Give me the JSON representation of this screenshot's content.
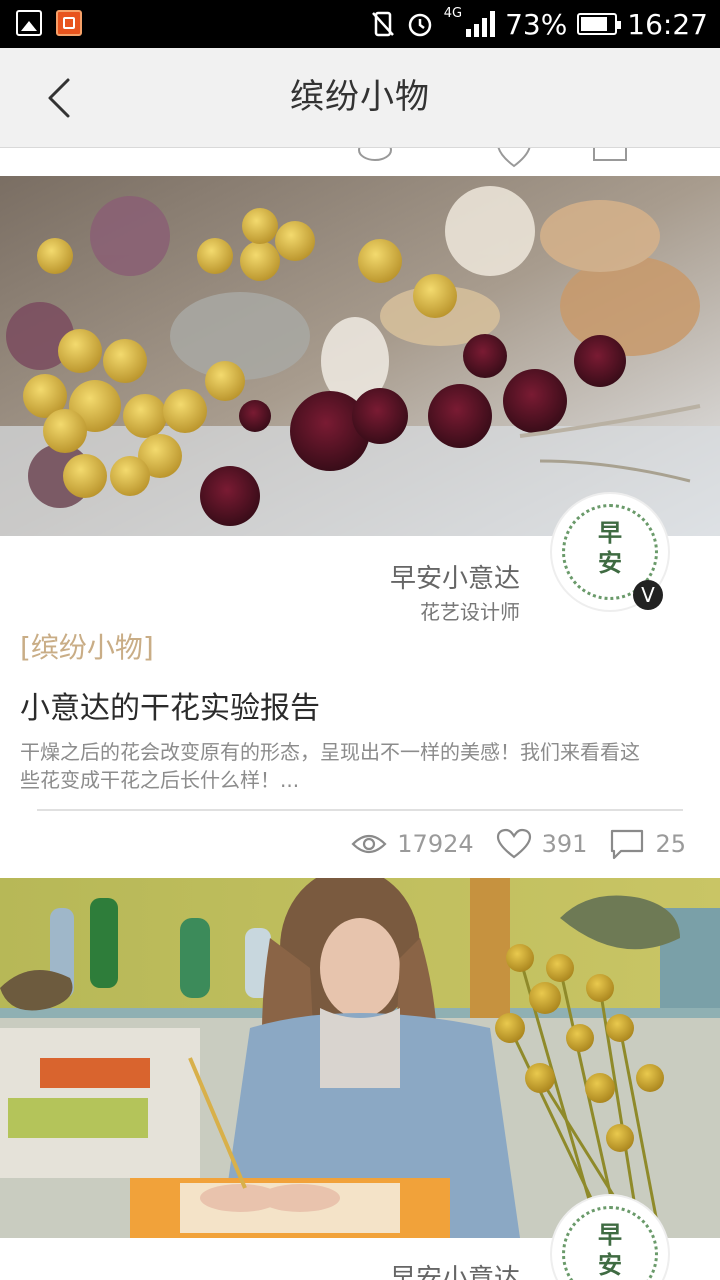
{
  "status_bar": {
    "battery": "73%",
    "time": "16:27",
    "network": "4G"
  },
  "header": {
    "title": "缤纷小物",
    "back_icon": "chevron-left-icon"
  },
  "posts": [
    {
      "author_name": "早安小意达",
      "author_role": "花艺设计师",
      "avatar_text": "早安",
      "verified_badge": "V",
      "category": "[缤纷小物]",
      "title": "小意达的干花实验报告",
      "excerpt": "干燥之后的花会改变原有的形态，呈现出不一样的美感！我们来看看这些花变成干花之后长什么样！...",
      "views": "17924",
      "likes": "391",
      "comments": "25"
    },
    {
      "author_name": "早安小意达",
      "avatar_text": "早安"
    }
  ],
  "colors": {
    "category": "#c9ad86",
    "title_bar": "#f1f1f1",
    "status_bar": "#000000"
  }
}
